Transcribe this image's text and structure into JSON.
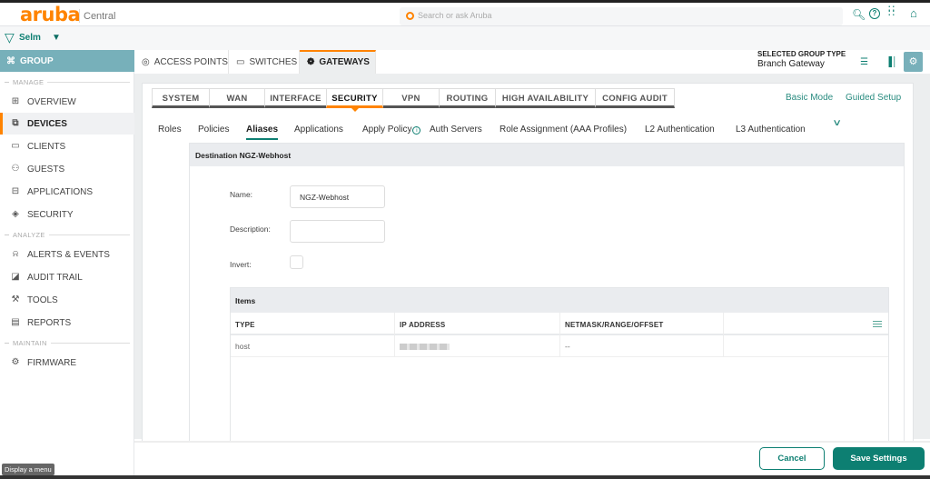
{
  "header": {
    "logo": "aruba",
    "product": "Central",
    "search_placeholder": "Search or ask Aruba",
    "icons": [
      "search-icon",
      "help-icon",
      "apps-grid-icon",
      "user-icon"
    ]
  },
  "filter": {
    "label": "Selm"
  },
  "sidebar": {
    "group_label": "GROUP",
    "sections": [
      {
        "label": "MANAGE"
      },
      {
        "label": "ANALYZE"
      },
      {
        "label": "MAINTAIN"
      }
    ],
    "items": [
      {
        "label": "OVERVIEW",
        "icon": "overview-icon"
      },
      {
        "label": "DEVICES",
        "icon": "devices-icon",
        "active": true
      },
      {
        "label": "CLIENTS",
        "icon": "clients-icon"
      },
      {
        "label": "GUESTS",
        "icon": "guests-icon"
      },
      {
        "label": "APPLICATIONS",
        "icon": "applications-icon"
      },
      {
        "label": "SECURITY",
        "icon": "security-icon"
      },
      {
        "label": "ALERTS & EVENTS",
        "icon": "bell-icon"
      },
      {
        "label": "AUDIT TRAIL",
        "icon": "audit-trail-icon"
      },
      {
        "label": "TOOLS",
        "icon": "wrench-icon"
      },
      {
        "label": "REPORTS",
        "icon": "reports-icon"
      },
      {
        "label": "FIRMWARE",
        "icon": "firmware-gear-icon"
      }
    ],
    "tooltip": "Display a menu"
  },
  "device_tabs": [
    {
      "label": "ACCESS POINTS",
      "icon": "access-point-icon"
    },
    {
      "label": "SWITCHES",
      "icon": "switch-icon"
    },
    {
      "label": "GATEWAYS",
      "icon": "gateway-icon",
      "active": true
    }
  ],
  "group_type": {
    "label": "SELECTED GROUP TYPE",
    "value": "Branch Gateway"
  },
  "config_tabs": [
    {
      "label": "SYSTEM"
    },
    {
      "label": "WAN"
    },
    {
      "label": "INTERFACE"
    },
    {
      "label": "SECURITY",
      "active": true
    },
    {
      "label": "VPN"
    },
    {
      "label": "ROUTING"
    },
    {
      "label": "HIGH AVAILABILITY"
    },
    {
      "label": "CONFIG AUDIT"
    }
  ],
  "mode_links": {
    "basic": "Basic Mode",
    "guided": "Guided Setup"
  },
  "security_tabs": [
    {
      "label": "Roles"
    },
    {
      "label": "Policies"
    },
    {
      "label": "Aliases",
      "active": true
    },
    {
      "label": "Applications"
    },
    {
      "label": "Apply Policy"
    },
    {
      "label": "Auth Servers"
    },
    {
      "label": "Role Assignment (AAA Profiles)"
    },
    {
      "label": "L2 Authentication"
    },
    {
      "label": "L3 Authentication"
    }
  ],
  "alias": {
    "title": "Destination NGZ-Webhost",
    "name_label": "Name:",
    "name_value": "NGZ-Webhost",
    "description_label": "Description:",
    "description_value": "",
    "invert_label": "Invert:",
    "invert_checked": false
  },
  "items_table": {
    "title": "Items",
    "columns": [
      "TYPE",
      "IP ADDRESS",
      "NETMASK/RANGE/OFFSET"
    ],
    "rows": [
      {
        "type": "host",
        "ip": "[redacted]",
        "netmask": "--"
      }
    ]
  },
  "footer": {
    "cancel": "Cancel",
    "save": "Save Settings"
  },
  "colors": {
    "brand_orange": "#ff8300",
    "accent_teal": "#0d7f72",
    "group_bg": "#77b0ba"
  }
}
